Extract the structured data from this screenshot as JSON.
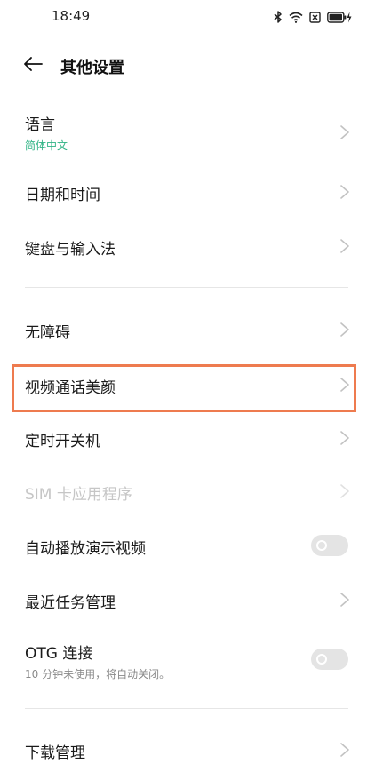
{
  "status_bar": {
    "time": "18:49",
    "icons": [
      "bluetooth-icon",
      "wifi-icon",
      "sim-off-icon",
      "battery-charging-icon"
    ]
  },
  "header": {
    "back_icon": "arrow-left-icon",
    "title": "其他设置"
  },
  "items": [
    {
      "title": "语言",
      "subtitle": "简体中文",
      "control": "chevron",
      "enabled": true
    },
    {
      "title": "日期和时间",
      "control": "chevron",
      "enabled": true
    },
    {
      "title": "键盘与输入法",
      "control": "chevron",
      "enabled": true
    },
    {
      "title": "无障碍",
      "control": "chevron",
      "enabled": true
    },
    {
      "title": "视频通话美颜",
      "control": "chevron",
      "enabled": true,
      "highlighted": true
    },
    {
      "title": "定时开关机",
      "control": "chevron",
      "enabled": true
    },
    {
      "title": "SIM 卡应用程序",
      "control": "chevron",
      "enabled": false
    },
    {
      "title": "自动播放演示视频",
      "control": "toggle",
      "enabled": true,
      "on": false
    },
    {
      "title": "最近任务管理",
      "control": "chevron",
      "enabled": true
    },
    {
      "title": "OTG 连接",
      "subtitle": "10 分钟未使用，将自动关闭。",
      "control": "toggle",
      "enabled": true,
      "on": false
    },
    {
      "title": "下载管理",
      "control": "chevron",
      "enabled": true
    }
  ],
  "colors": {
    "accent_green": "#2fb385",
    "highlight_orange": "#ee7b4f",
    "toggle_off": "#e4e4e4",
    "disabled_text": "#c6c6c6"
  }
}
